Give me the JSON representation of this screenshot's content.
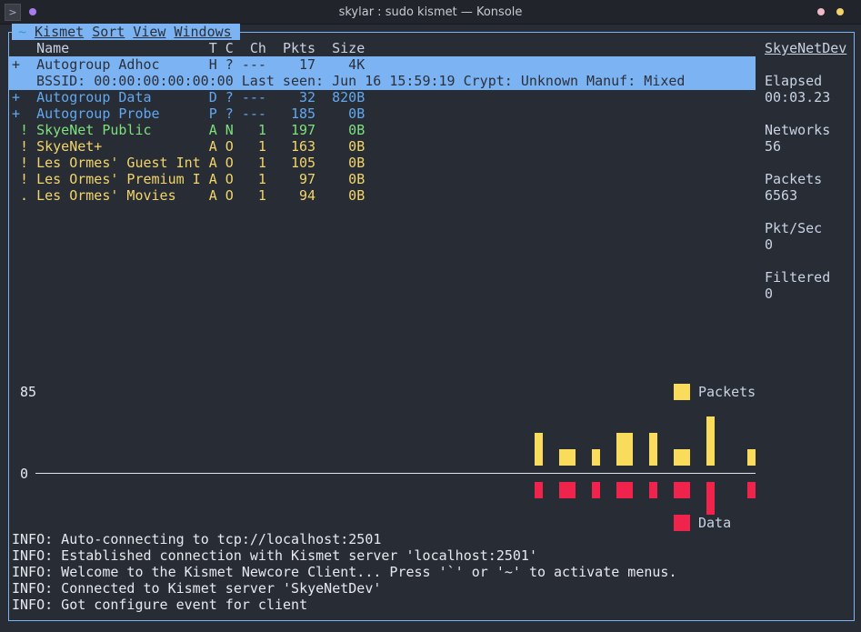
{
  "window": {
    "title": "skylar : sudo kismet — Konsole"
  },
  "menu": {
    "items": [
      "Kismet",
      "Sort",
      "View",
      "Windows"
    ],
    "tilde": "~"
  },
  "columns": {
    "name": "Name",
    "t": "T",
    "c": "C",
    "ch": "Ch",
    "pkts": "Pkts",
    "size": "Size"
  },
  "networks": [
    {
      "prefix": "+",
      "name": "Autogroup Adhoc",
      "t": "H",
      "c": "?",
      "ch": "---",
      "pkts": "17",
      "size": "4K",
      "color": "#2b303b",
      "selected": true
    },
    {
      "prefix": "+",
      "name": "Autogroup Data",
      "t": "D",
      "c": "?",
      "ch": "---",
      "pkts": "32",
      "size": "820B",
      "color": "#61a8f0"
    },
    {
      "prefix": "+",
      "name": "Autogroup Probe",
      "t": "P",
      "c": "?",
      "ch": "---",
      "pkts": "185",
      "size": "0B",
      "color": "#61a8f0"
    },
    {
      "prefix": " !",
      "name": "SkyeNet Public",
      "t": "A",
      "c": "N",
      "ch": "1",
      "pkts": "197",
      "size": "0B",
      "color": "#7ee07e"
    },
    {
      "prefix": " !",
      "name": "SkyeNet+",
      "t": "A",
      "c": "O",
      "ch": "1",
      "pkts": "163",
      "size": "0B",
      "color": "#f2d56a"
    },
    {
      "prefix": " !",
      "name": "Les Ormes' Guest Int",
      "t": "A",
      "c": "O",
      "ch": "1",
      "pkts": "105",
      "size": "0B",
      "color": "#f2d56a"
    },
    {
      "prefix": " !",
      "name": "Les Ormes' Premium I",
      "t": "A",
      "c": "O",
      "ch": "1",
      "pkts": "97",
      "size": "0B",
      "color": "#f2d56a"
    },
    {
      "prefix": " .",
      "name": "Les Ormes' Movies",
      "t": "A",
      "c": "O",
      "ch": "1",
      "pkts": "94",
      "size": "0B",
      "color": "#f2d56a"
    }
  ],
  "selected_detail": "BSSID: 00:00:00:00:00:00 Last seen: Jun 16 15:59:19 Crypt: Unknown Manuf: Mixed",
  "sidebar": {
    "server": "SkyeNetDev",
    "stats": [
      {
        "label": "Elapsed",
        "value": "00:03.23"
      },
      {
        "label": "Networks",
        "value": "56"
      },
      {
        "label": "Packets",
        "value": "6563"
      },
      {
        "label": "Pkt/Sec",
        "value": "0"
      },
      {
        "label": "Filtered",
        "value": "0"
      }
    ]
  },
  "chart_data": {
    "type": "bar",
    "ylim_labels": {
      "max": "85",
      "zero": "0"
    },
    "series": [
      {
        "name": "Packets",
        "color": "#f9dc5c",
        "values": [
          34,
          17,
          17,
          34,
          34,
          17,
          51,
          17
        ]
      },
      {
        "name": "Data",
        "color": "#ef234c",
        "values": [
          17,
          17,
          17,
          17,
          17,
          17,
          34,
          17
        ]
      }
    ]
  },
  "log": [
    "INFO: Auto-connecting to tcp://localhost:2501",
    "INFO: Established connection with Kismet server 'localhost:2501'",
    "INFO: Welcome to the Kismet Newcore Client... Press '`' or '~' to activate menus.",
    "INFO: Connected to Kismet server 'SkyeNetDev'",
    "INFO: Got configure event for client"
  ]
}
